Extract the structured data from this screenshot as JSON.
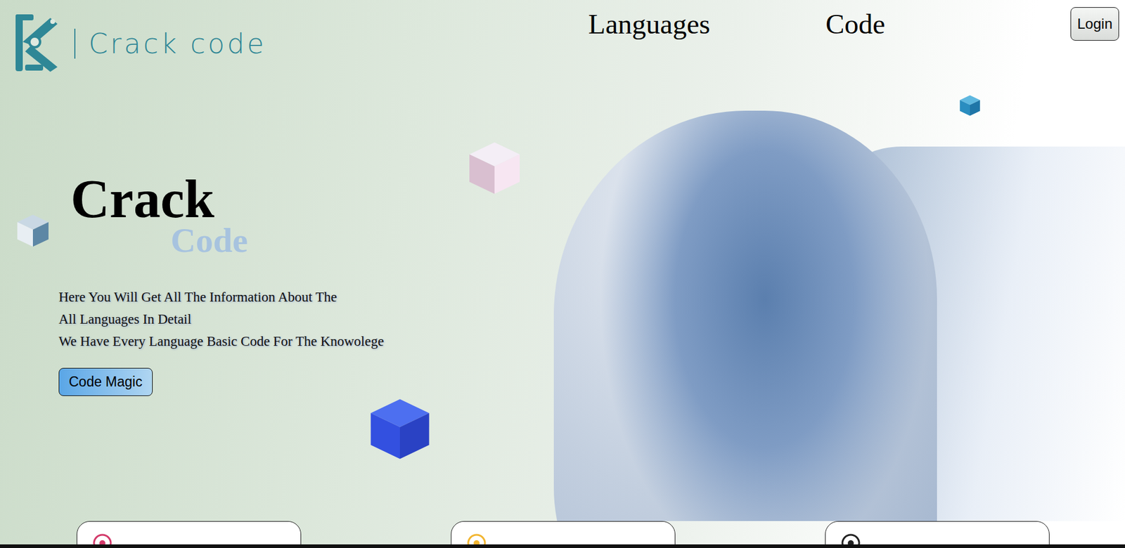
{
  "logo": {
    "text": "Crack code"
  },
  "nav": {
    "items": [
      {
        "label": "Languages"
      },
      {
        "label": "Code"
      }
    ]
  },
  "login_button": {
    "label": "Login"
  },
  "hero": {
    "title": "Crack",
    "subtitle": "Code",
    "lines": [
      "Here You Will Get All The Information About The",
      "All Languages In Detail",
      "We Have Every Language Basic Code For The Knowolege"
    ],
    "button": {
      "label": "Code Magic"
    }
  },
  "feature_cards": [
    {
      "selected": false
    },
    {
      "selected": false
    },
    {
      "selected": false
    }
  ]
}
